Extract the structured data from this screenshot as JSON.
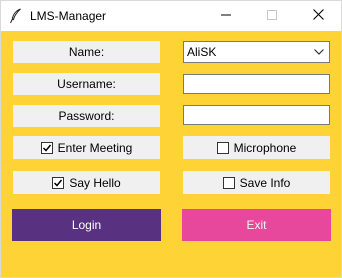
{
  "window": {
    "title": "LMS-Manager",
    "background_color": "#fdd335"
  },
  "titlebar": {
    "app_icon": "feather-icon",
    "minimize_icon": "minimize-icon",
    "maximize_icon": "maximize-icon",
    "close_icon": "close-icon"
  },
  "form": {
    "name_label": "Name:",
    "name_value": "AliSK",
    "username_label": "Username:",
    "username_value": "",
    "password_label": "Password:",
    "password_value": ""
  },
  "options": {
    "enter_meeting": {
      "label": "Enter Meeting",
      "checked": true
    },
    "microphone": {
      "label": "Microphone",
      "checked": false
    },
    "say_hello": {
      "label": "Say Hello",
      "checked": true
    },
    "save_info": {
      "label": "Save Info",
      "checked": false
    }
  },
  "buttons": {
    "login_label": "Login",
    "login_color": "#583181",
    "exit_label": "Exit",
    "exit_color": "#e8489b"
  }
}
